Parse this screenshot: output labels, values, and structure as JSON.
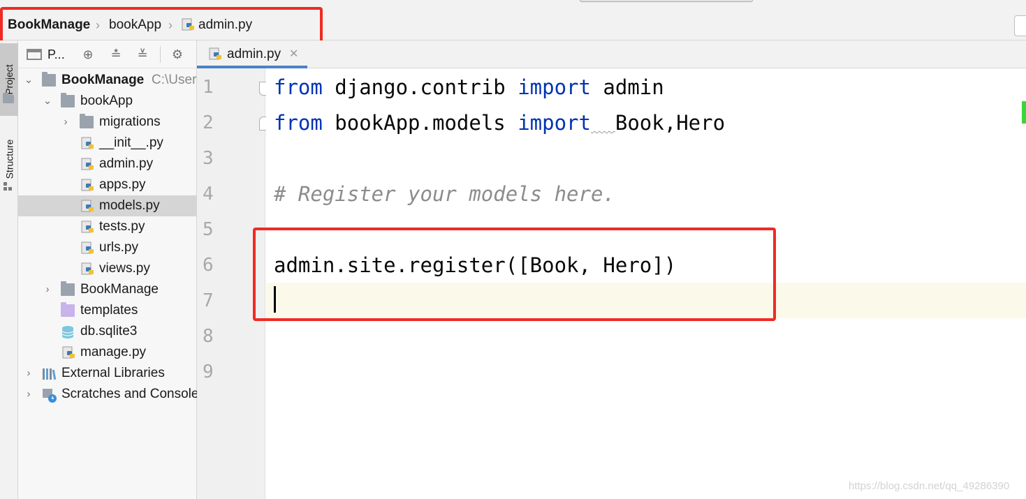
{
  "breadcrumb": {
    "project": "BookManage",
    "module": "bookApp",
    "file": "admin.py"
  },
  "left_strip": {
    "project_tab": "Project",
    "structure_tab": "Structure"
  },
  "project_panel": {
    "title": "P..."
  },
  "tree": {
    "root_name": "BookManage",
    "root_path": "C:\\Users",
    "items": [
      {
        "label": "bookApp"
      },
      {
        "label": "migrations"
      },
      {
        "label": "__init__.py"
      },
      {
        "label": "admin.py"
      },
      {
        "label": "apps.py"
      },
      {
        "label": "models.py"
      },
      {
        "label": "tests.py"
      },
      {
        "label": "urls.py"
      },
      {
        "label": "views.py"
      },
      {
        "label": "BookManage"
      },
      {
        "label": "templates"
      },
      {
        "label": "db.sqlite3"
      },
      {
        "label": "manage.py"
      },
      {
        "label": "External Libraries"
      },
      {
        "label": "Scratches and Consoles"
      }
    ]
  },
  "editor": {
    "tab_label": "admin.py",
    "line_numbers": [
      "1",
      "2",
      "3",
      "4",
      "5",
      "6",
      "7",
      "8",
      "9"
    ],
    "line1": {
      "kw1": "from",
      "mod": " django.contrib ",
      "kw2": "import",
      "name": " admin"
    },
    "line2": {
      "kw1": "from",
      "mod": " bookApp.models ",
      "kw2": "import",
      "gap": "  ",
      "names": "Book,Hero"
    },
    "line4_comment": "# Register your models here.",
    "line6": "admin.site.register([Book, Hero])"
  },
  "colors": {
    "keyword": "#0033b3",
    "comment": "#8c8c8c",
    "annotation_red": "#ef2b23",
    "active_tab_underline": "#4a83c6"
  },
  "watermark": "https://blog.csdn.net/qq_49286390"
}
